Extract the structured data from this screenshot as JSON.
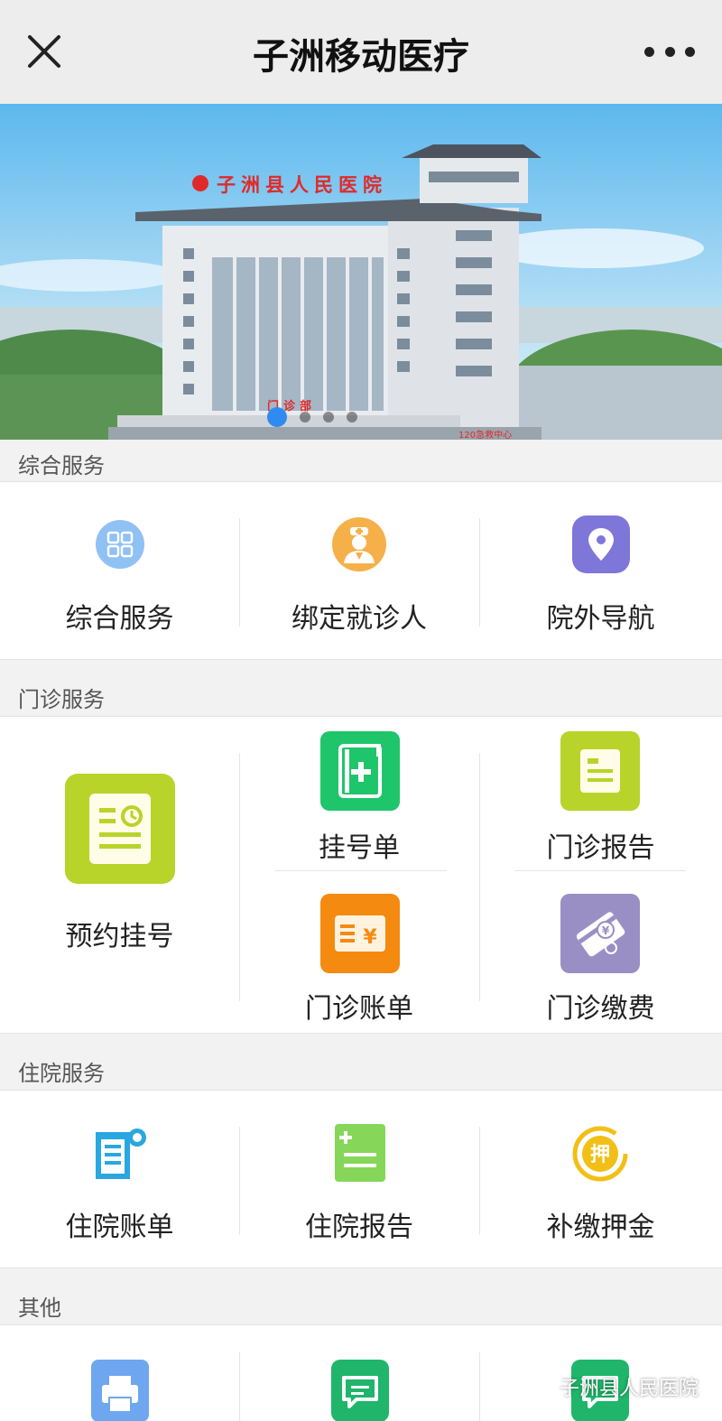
{
  "navbar": {
    "title": "子洲移动医疗",
    "close_icon": "close-icon",
    "more_icon": "more-dots-icon"
  },
  "banner": {
    "hospital_sign": "子洲县人民医院",
    "door_sign": "门诊部",
    "ambulance_sign": "120急救中心",
    "slide_count": 4,
    "active_slide": 1
  },
  "sections": {
    "general": {
      "title": "综合服务",
      "items": [
        {
          "label": "综合服务",
          "icon": "grid-icon",
          "color": "#8fc1f5"
        },
        {
          "label": "绑定就诊人",
          "icon": "doctor-icon",
          "color": "#f6b04a"
        },
        {
          "label": "院外导航",
          "icon": "location-pin-icon",
          "color": "#7e76d8"
        }
      ]
    },
    "outpatient": {
      "title": "门诊服务",
      "items": [
        {
          "label": "预约挂号",
          "icon": "appointment-icon",
          "color": "#b8d42a"
        },
        {
          "label": "挂号单",
          "icon": "registration-slip-icon",
          "color": "#1fc56b"
        },
        {
          "label": "门诊报告",
          "icon": "report-icon",
          "color": "#b8d42a"
        },
        {
          "label": "门诊账单",
          "icon": "bill-icon",
          "color": "#f58a10"
        },
        {
          "label": "门诊缴费",
          "icon": "payment-icon",
          "color": "#9a8fc4"
        }
      ]
    },
    "inpatient": {
      "title": "住院服务",
      "items": [
        {
          "label": "住院账单",
          "icon": "scroll-bill-icon",
          "color": "#2aa6e0"
        },
        {
          "label": "住院报告",
          "icon": "clipboard-report-icon",
          "color": "#86d65a"
        },
        {
          "label": "补缴押金",
          "icon": "deposit-icon",
          "color": "#f2bf16"
        }
      ]
    },
    "other": {
      "title": "其他",
      "items": [
        {
          "label": "",
          "icon": "printer-icon",
          "color": "#6fa6f0"
        },
        {
          "label": "",
          "icon": "chat-icon",
          "color": "#1fb56a"
        },
        {
          "label": "",
          "icon": "message-icon",
          "color": "#1fb56a"
        }
      ]
    }
  },
  "watermark": {
    "text": "子洲县人民医院",
    "icon": "wechat-icon"
  }
}
